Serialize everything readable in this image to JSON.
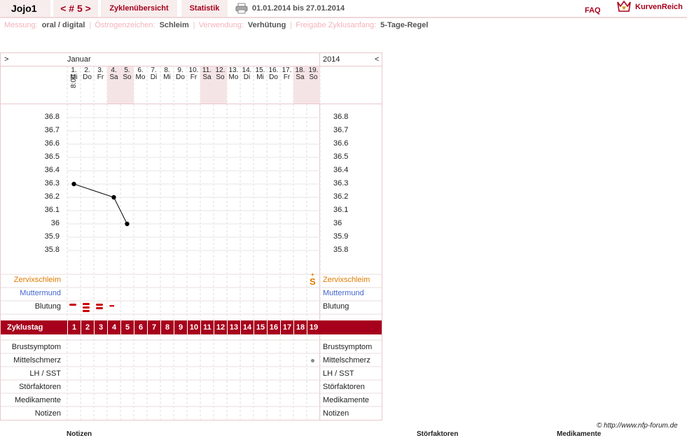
{
  "topbar": {
    "user": "Jojo1",
    "cycle_label": "< # 5 >",
    "overview_label": "Zyklenübersicht",
    "stats_label": "Statistik",
    "date_range": "01.01.2014 bis 27.01.2014",
    "faq_label": "FAQ",
    "brand_label": "KurvenReich",
    "print_icon": "printer-icon",
    "logo_icon": "crown-heart-icon"
  },
  "settings": [
    {
      "label": "Messung:",
      "value": "oral / digital"
    },
    {
      "label": "Östrogenzeichen:",
      "value": "Schleim"
    },
    {
      "label": "Verwendung:",
      "value": "Verhütung"
    },
    {
      "label": "Freigabe Zyklusanfang:",
      "value": "5-Tage-Regel"
    }
  ],
  "chart_header": {
    "left_arrow": ">",
    "month": "Januar",
    "year": "2014",
    "right_arrow": "<",
    "time": "8:00"
  },
  "days": [
    {
      "num": "1.",
      "wd": "Mi",
      "weekend": false
    },
    {
      "num": "2.",
      "wd": "Do",
      "weekend": false
    },
    {
      "num": "3.",
      "wd": "Fr",
      "weekend": false
    },
    {
      "num": "4.",
      "wd": "Sa",
      "weekend": true
    },
    {
      "num": "5.",
      "wd": "So",
      "weekend": true
    },
    {
      "num": "6.",
      "wd": "Mo",
      "weekend": false
    },
    {
      "num": "7.",
      "wd": "Di",
      "weekend": false
    },
    {
      "num": "8.",
      "wd": "Mi",
      "weekend": false
    },
    {
      "num": "9.",
      "wd": "Do",
      "weekend": false
    },
    {
      "num": "10.",
      "wd": "Fr",
      "weekend": false
    },
    {
      "num": "11.",
      "wd": "Sa",
      "weekend": true
    },
    {
      "num": "12.",
      "wd": "So",
      "weekend": true
    },
    {
      "num": "13.",
      "wd": "Mo",
      "weekend": false
    },
    {
      "num": "14.",
      "wd": "Di",
      "weekend": false
    },
    {
      "num": "15.",
      "wd": "Mi",
      "weekend": false
    },
    {
      "num": "16.",
      "wd": "Do",
      "weekend": false
    },
    {
      "num": "17.",
      "wd": "Fr",
      "weekend": false
    },
    {
      "num": "18.",
      "wd": "Sa",
      "weekend": true
    },
    {
      "num": "19.",
      "wd": "So",
      "weekend": true
    }
  ],
  "y_ticks": [
    "36.8",
    "36.7",
    "36.6",
    "36.5",
    "36.4",
    "36.3",
    "36.2",
    "36.1",
    "36",
    "35.9",
    "35.8"
  ],
  "chart_data": {
    "type": "line",
    "x": [
      1,
      4,
      5
    ],
    "y": [
      36.3,
      36.2,
      36.0
    ],
    "ylim": [
      35.8,
      36.8
    ]
  },
  "rows_top": {
    "zervix": "Zervixschleim",
    "muttermund": "Muttermund",
    "blutung": "Blutung",
    "zervix_marker": "S"
  },
  "zyklustag_label": "Zyklustag",
  "zyklustag_nums": [
    "1",
    "2",
    "3",
    "4",
    "5",
    "6",
    "7",
    "8",
    "9",
    "10",
    "11",
    "12",
    "13",
    "14",
    "15",
    "16",
    "17",
    "18",
    "19"
  ],
  "rows_bottom": [
    "Brustsymptom",
    "Mittelschmerz",
    "LH / SST",
    "Störfaktoren",
    "Medikamente",
    "Notizen"
  ],
  "colors": {
    "accent": "#a7001c",
    "zervix": "#e07b00",
    "muttermund": "#4466cc",
    "blood": "#cc0000"
  },
  "footer": "© http://www.nfp-forum.de",
  "bottom_labels": [
    "Notizen",
    "Störfaktoren",
    "Medikamente"
  ]
}
